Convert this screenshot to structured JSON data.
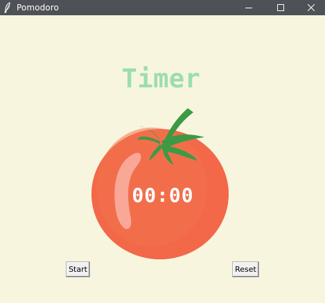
{
  "window": {
    "title": "Pomodoro",
    "app_icon": "feather-icon",
    "controls": [
      "minimize-icon",
      "maximize-icon",
      "close-icon"
    ]
  },
  "main": {
    "heading": "Timer",
    "timer_value": "00:00",
    "image": "tomato-icon"
  },
  "buttons": {
    "start_label": "Start",
    "reset_label": "Reset"
  },
  "colors": {
    "background": "#f7f5de",
    "heading": "#9bdeab",
    "tomato": "#f26849",
    "leaves": "#3c9a45",
    "titlebar": "#4e5257"
  }
}
